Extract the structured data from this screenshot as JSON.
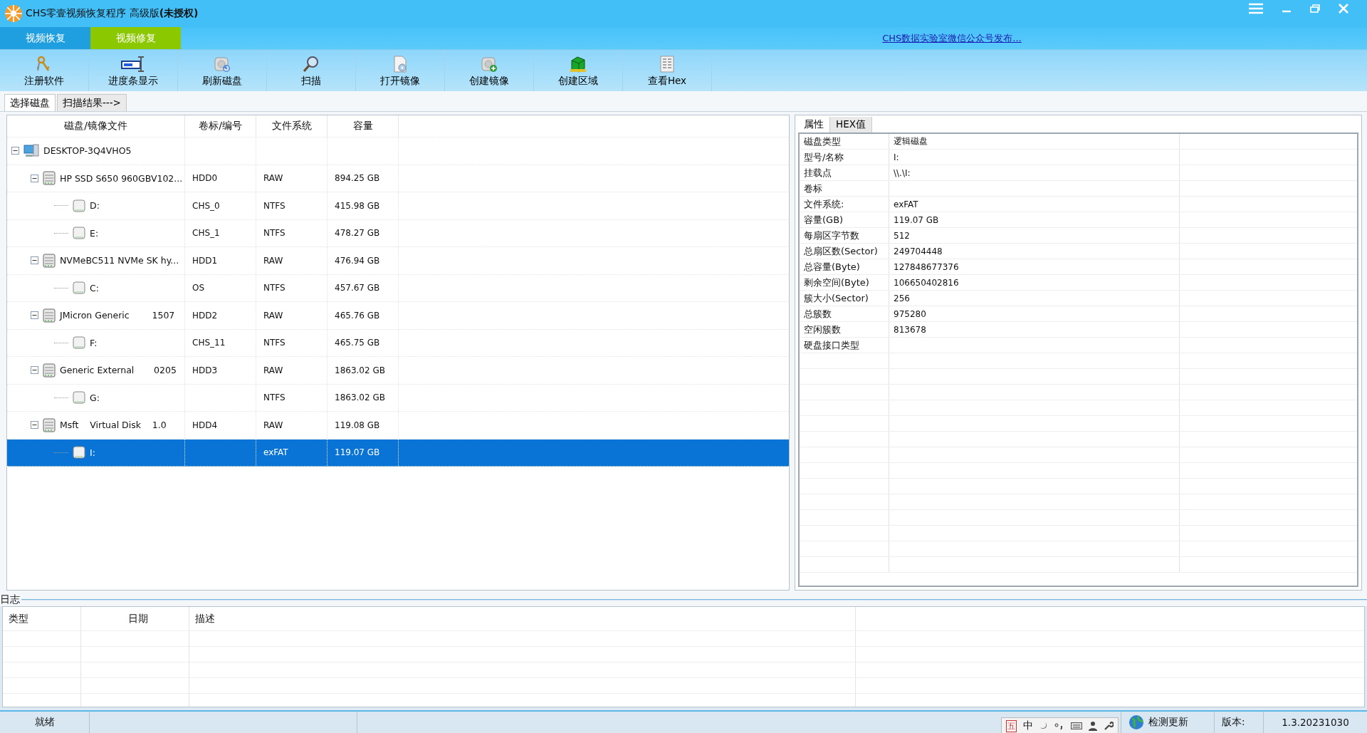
{
  "window": {
    "title": "CHS零壹视频恢复程序 高级版**(未授权)**"
  },
  "mode_tabs": [
    {
      "label": "视频恢复",
      "color": "#1f9fe0"
    },
    {
      "label": "视频修复",
      "color": "#8cc800"
    }
  ],
  "notice_link": "CHS数据实验室微信公众号发布...",
  "toolbar": [
    {
      "label": "注册软件",
      "kind": "keys"
    },
    {
      "label": "进度条显示",
      "kind": "progress"
    },
    {
      "label": "刷新磁盘",
      "kind": "refresh"
    },
    {
      "label": "扫描",
      "kind": "scan"
    },
    {
      "label": "打开镜像",
      "kind": "open"
    },
    {
      "label": "创建镜像",
      "kind": "create"
    },
    {
      "label": "创建区域",
      "kind": "region"
    },
    {
      "label": "查看Hex",
      "kind": "hex"
    }
  ],
  "page_tabs": [
    {
      "label": "选择磁盘",
      "selected": true
    },
    {
      "label": "扫描结果--->",
      "selected": false
    }
  ],
  "disk_tree": {
    "columns": [
      "磁盘/镜像文件",
      "卷标/编号",
      "文件系统",
      "容量"
    ],
    "nodes": [
      {
        "kind": "computer",
        "name": "DESKTOP-3Q4VHO5",
        "expanded": true,
        "selected": false,
        "children": [
          {
            "kind": "disk",
            "name": "HP SSD S650 960GBV102...",
            "label": "HDD0",
            "fs": "RAW",
            "size": "894.25 GB",
            "expanded": true,
            "selected": false,
            "children": [
              {
                "kind": "volume",
                "name": "D:",
                "label": "CHS_0",
                "fs": "NTFS",
                "size": "415.98 GB",
                "selected": false
              },
              {
                "kind": "volume",
                "name": "E:",
                "label": "CHS_1",
                "fs": "NTFS",
                "size": "478.27 GB",
                "selected": false
              }
            ]
          },
          {
            "kind": "disk",
            "name": "NVMeBC511 NVMe SK hy...",
            "label": "HDD1",
            "fs": "RAW",
            "size": "476.94 GB",
            "expanded": true,
            "selected": false,
            "children": [
              {
                "kind": "volume",
                "name": "C:",
                "label": "OS",
                "fs": "NTFS",
                "size": "457.67 GB",
                "selected": false
              }
            ]
          },
          {
            "kind": "disk",
            "name": "JMicron Generic        1507",
            "label": "HDD2",
            "fs": "RAW",
            "size": "465.76 GB",
            "expanded": true,
            "selected": false,
            "children": [
              {
                "kind": "volume",
                "name": "F:",
                "label": "CHS_11",
                "fs": "NTFS",
                "size": "465.75 GB",
                "selected": false
              }
            ]
          },
          {
            "kind": "disk",
            "name": "Generic External       0205",
            "label": "HDD3",
            "fs": "RAW",
            "size": "1863.02 GB",
            "expanded": true,
            "selected": false,
            "children": [
              {
                "kind": "volume",
                "name": "G:",
                "fs": "NTFS",
                "size": "1863.02 GB",
                "selected": false
              }
            ]
          },
          {
            "kind": "disk",
            "name": "Msft    Virtual Disk    1.0",
            "label": "HDD4",
            "fs": "RAW",
            "size": "119.08 GB",
            "expanded": true,
            "selected": false,
            "children": [
              {
                "kind": "volume",
                "name": "I:",
                "fs": "exFAT",
                "size": "119.07 GB",
                "selected": true
              }
            ]
          }
        ]
      }
    ]
  },
  "detail_tabs": [
    {
      "label": "属性",
      "selected": true
    },
    {
      "label": "HEX值",
      "selected": false
    }
  ],
  "properties": [
    {
      "name": "磁盘类型",
      "value": "逻辑磁盘"
    },
    {
      "name": "型号/名称",
      "value": "I:"
    },
    {
      "name": "挂载点",
      "value": "\\\\.\\I:"
    },
    {
      "name": "卷标"
    },
    {
      "name": "文件系统:",
      "value": "exFAT"
    },
    {
      "name": "容量(GB)",
      "value": "119.07 GB"
    },
    {
      "name": "每扇区字节数",
      "value": "512"
    },
    {
      "name": "总扇区数(Sector)",
      "value": "249704448"
    },
    {
      "name": "总容量(Byte)",
      "value": "127848677376"
    },
    {
      "name": "剩余空间(Byte)",
      "value": "106650402816"
    },
    {
      "name": "簇大小(Sector)",
      "value": "256"
    },
    {
      "name": "总簇数",
      "value": "975280"
    },
    {
      "name": "空闲簇数",
      "value": "813678"
    },
    {
      "name": "硬盘接口类型"
    }
  ],
  "log": {
    "title": "日志",
    "columns": [
      "类型",
      "日期",
      "描述"
    ]
  },
  "status_bar": {
    "state": "就绪",
    "ime": [
      "五",
      "中"
    ],
    "update": "检测更新",
    "version_label": "版本:",
    "version": "1.3.20231030"
  }
}
